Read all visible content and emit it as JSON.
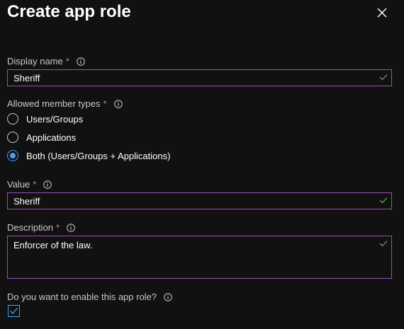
{
  "panel": {
    "title": "Create app role",
    "close_icon": "close-icon"
  },
  "display_name": {
    "label": "Display name",
    "required_marker": "*",
    "value": "Sheriff"
  },
  "member_types": {
    "label": "Allowed member types",
    "required_marker": "*",
    "options": [
      {
        "label": "Users/Groups",
        "selected": false
      },
      {
        "label": "Applications",
        "selected": false
      },
      {
        "label": "Both (Users/Groups + Applications)",
        "selected": true
      }
    ]
  },
  "value_field": {
    "label": "Value",
    "required_marker": "*",
    "value": "Sheriff"
  },
  "description": {
    "label": "Description",
    "required_marker": "*",
    "value": "Enforcer of the law."
  },
  "enable": {
    "label": "Do you want to enable this app role?",
    "checked": true
  },
  "colors": {
    "background": "#111111",
    "field_border": "#9a4fb5",
    "required": "#f1707b",
    "valid_check": "#5cb85c",
    "accent": "#4aa0f0"
  }
}
